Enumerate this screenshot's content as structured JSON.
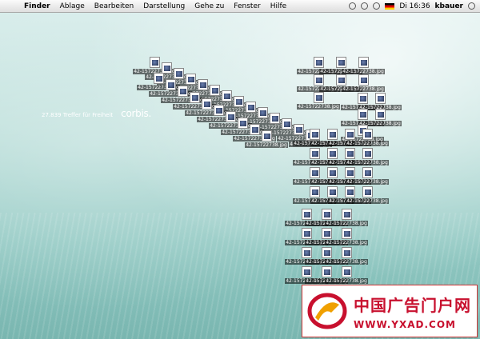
{
  "menubar": {
    "apple_label": "",
    "app_name": "Finder",
    "items": [
      "Ablage",
      "Bearbeiten",
      "Darstellung",
      "Gehe zu",
      "Fenster",
      "Hilfe"
    ],
    "clock": "Di 16:36",
    "user": "kbauer"
  },
  "desktop": {
    "tagline": "27.839 Treffer für Freiheit",
    "logo_text": "corbis."
  },
  "files": {
    "name": "42-15722738.jpg",
    "count": 64
  },
  "watermark": {
    "chinese": "中国广告门户网",
    "url": "WWW.YXAD.COM"
  },
  "colors": {
    "background_top": "#d6ecea",
    "background_bottom": "#79b6b0",
    "watermark_red": "#c8102e"
  }
}
